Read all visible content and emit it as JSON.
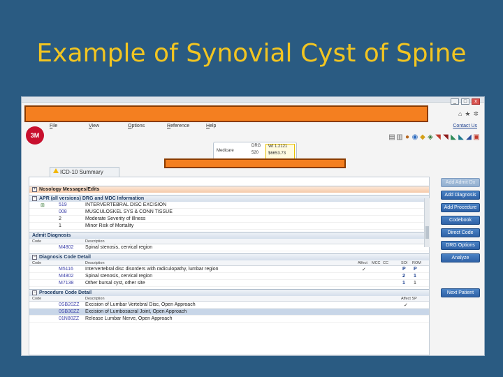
{
  "slide": {
    "title": "Example of Synovial Cyst of Spine"
  },
  "app": {
    "window_buttons": [
      "_",
      "□",
      "x"
    ],
    "contact_label": "Contact Us",
    "menu": [
      "File",
      "View",
      "Options",
      "Reference",
      "Help"
    ],
    "logo_text": "3M",
    "drg": {
      "plan": "Medicare",
      "label_drg": "DRG",
      "label_code": "520",
      "value_1": "Wt 1.2121",
      "value_2": "$6653.73"
    },
    "tab_label": "ICD-10 Summary"
  },
  "sections": {
    "nosology": "Nosology Messages/Edits",
    "apr": "APR (all versions) DRG and MDC Information",
    "admit": "Admit Diagnosis",
    "diag": "Diagnosis Code Detail",
    "proc": "Procedure Code Detail"
  },
  "apr_rows": [
    {
      "code": "519",
      "desc": "INTERVERTEBRAL DISC EXCISION"
    },
    {
      "code": "008",
      "desc": "MUSCULOSKEL SYS & CONN TISSUE"
    },
    {
      "code": "2",
      "desc": "Moderate Severity of Illness"
    },
    {
      "code": "1",
      "desc": "Minor Risk of Mortality"
    }
  ],
  "columns": {
    "code": "Code",
    "description": "Description",
    "affect": "Affect",
    "mcc": "MCC",
    "cc": "CC",
    "soi": "SOI",
    "rom": "ROM",
    "affect_sp": "Affect SP"
  },
  "admit_rows": [
    {
      "code": "M4802",
      "desc": "Spinal stenosis, cervical region"
    }
  ],
  "diag_rows": [
    {
      "code": "M5116",
      "desc": "Intervertebral disc disorders with radiculopathy, lumbar region",
      "affect": "✓",
      "soi": "P",
      "rom": "P"
    },
    {
      "code": "M4802",
      "desc": "Spinal stenosis, cervical region",
      "affect": "",
      "soi": "2",
      "rom": "1"
    },
    {
      "code": "M7138",
      "desc": "Other bursal cyst, other site",
      "affect": "",
      "soi": "1",
      "rom": "1"
    }
  ],
  "proc_rows": [
    {
      "code": "0SB20ZZ",
      "desc": "Excision of Lumbar Vertebral Disc, Open Approach",
      "affect": "✓"
    },
    {
      "code": "0SB30ZZ",
      "desc": "Excision of Lumbosacral Joint, Open Approach",
      "affect": ""
    },
    {
      "code": "01N80ZZ",
      "desc": "Release Lumbar Nerve, Open Approach",
      "affect": ""
    }
  ],
  "buttons": {
    "add_admit": "Add Admit Dx",
    "add_diagnosis": "Add Diagnosis",
    "add_procedure": "Add Procedure",
    "codebook": "Codebook",
    "direct_code": "Direct Code",
    "drg_options": "DRG Options",
    "analyze": "Analyze",
    "next_patient": "Next Patient"
  }
}
